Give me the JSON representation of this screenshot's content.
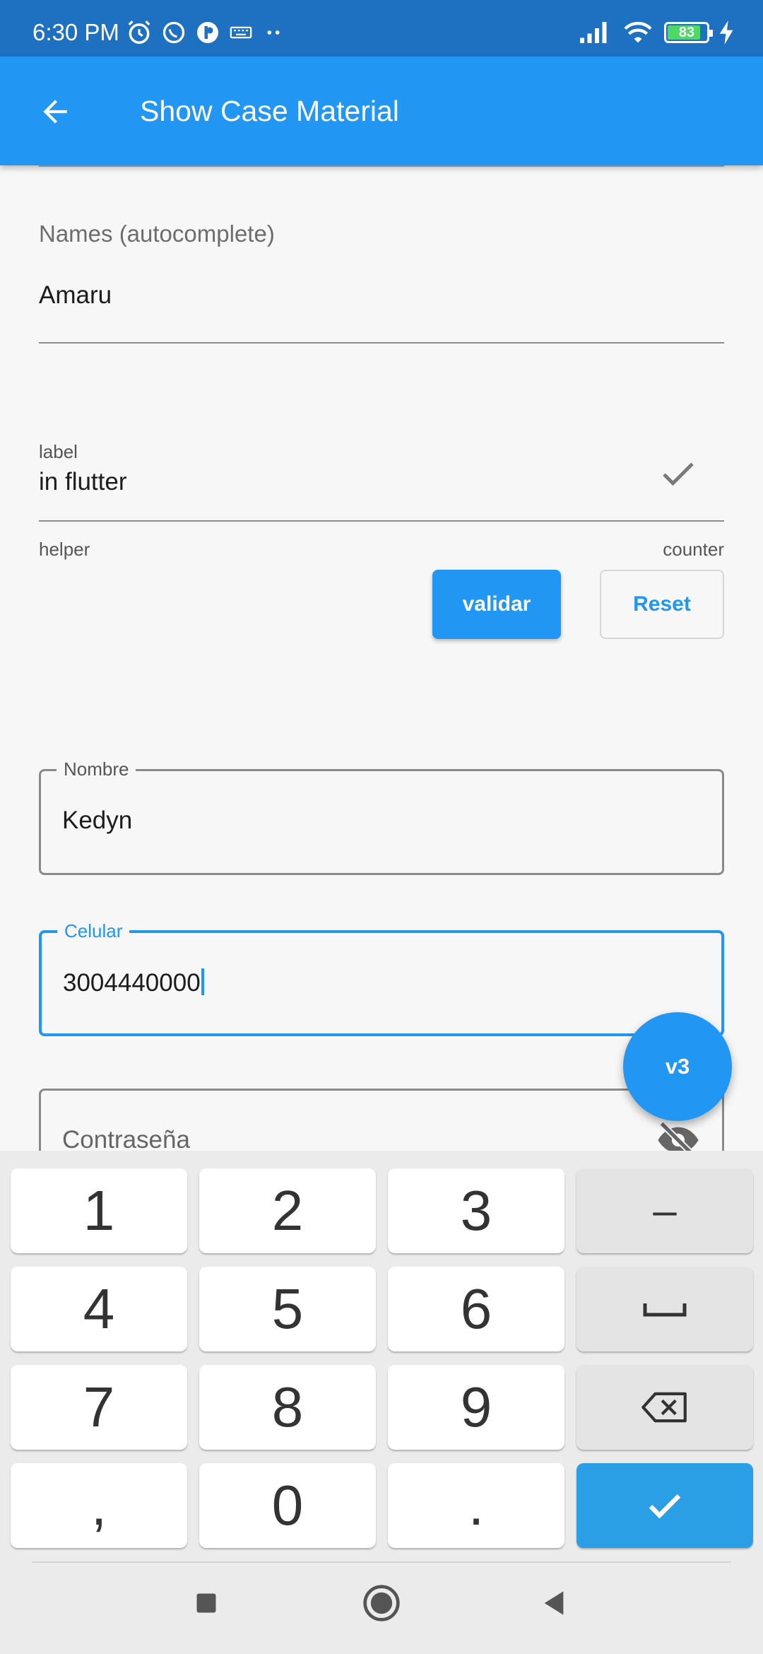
{
  "status_bar": {
    "time": "6:30 PM",
    "battery_level": "83"
  },
  "app_bar": {
    "title": "Show Case Material",
    "back_icon": "arrow-back-icon"
  },
  "form": {
    "names_autocomplete": {
      "label": "Names (autocomplete)",
      "value": "Amaru"
    },
    "flutter_field": {
      "label": "label",
      "value": "in flutter",
      "helper": "helper",
      "counter": "counter",
      "suffix_icon": "check-icon"
    },
    "buttons": {
      "validar": "validar",
      "reset": "Reset"
    },
    "nombre": {
      "label": "Nombre",
      "value": "Kedyn"
    },
    "celular": {
      "label": "Celular",
      "value": "3004440000"
    },
    "password": {
      "placeholder": "Contraseña",
      "suffix_icon": "eye-off-icon"
    }
  },
  "fab": {
    "label": "v3"
  },
  "keyboard": {
    "keys": [
      "1",
      "2",
      "3",
      "4",
      "5",
      "6",
      "7",
      "8",
      "9",
      ",",
      "0",
      "."
    ],
    "function_keys": {
      "minus": "–",
      "space_icon": "space-icon",
      "backspace_icon": "backspace-icon",
      "done_icon": "check-icon"
    }
  },
  "colors": {
    "status_bar": "#1d71c0",
    "app_bar": "#2196f3",
    "accent": "#2196f3",
    "background": "#f7f7f7",
    "keyboard_bg": "#ebebeb",
    "done_key": "#2b9fe6"
  }
}
